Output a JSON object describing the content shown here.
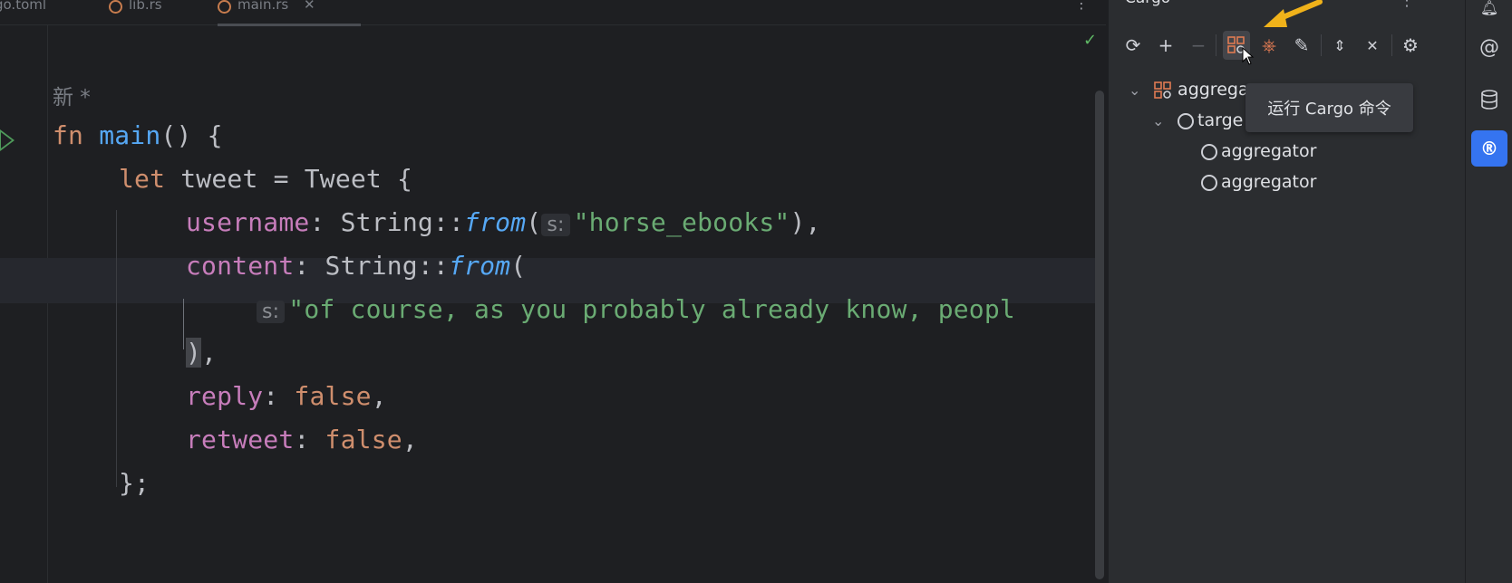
{
  "editor": {
    "tabs": [
      {
        "label": "go.toml"
      },
      {
        "label": "lib.rs"
      },
      {
        "label": "main.rs"
      }
    ],
    "new_marker": "新 *",
    "hint_s": "s:",
    "lines": {
      "l1_fn": "fn",
      "l1_name": "main",
      "l1_rest": "() {",
      "l2_let": "let",
      "l2_rest": " tweet = Tweet {",
      "l3_field": "username",
      "l3_mid": ": String::",
      "l3_from": "from",
      "l3_open": "(",
      "l3_str": "\"horse_ebooks\"",
      "l3_close": "),",
      "l4_field": "content",
      "l4_mid": ": String::",
      "l4_from": "from",
      "l4_open": "(",
      "l5_str": "\"of course, as you probably already know, peopl",
      "l6_close": ")",
      "l6_comma": ",",
      "l7_field": "reply",
      "l7_colon": ": ",
      "l7_val": "false",
      "l7_comma": ",",
      "l8_field": "retweet",
      "l8_colon": ": ",
      "l8_val": "false",
      "l8_comma": ",",
      "l9_close": "};"
    }
  },
  "cargo": {
    "title": "Cargo",
    "tooltip": "运行 Cargo 命令",
    "tree": [
      {
        "label": "aggrega"
      },
      {
        "label": "targe"
      },
      {
        "label": "aggregator"
      },
      {
        "label": "aggregator"
      }
    ]
  },
  "colors": {
    "accent": "#3574f0",
    "arrow": "#f0b21a"
  }
}
